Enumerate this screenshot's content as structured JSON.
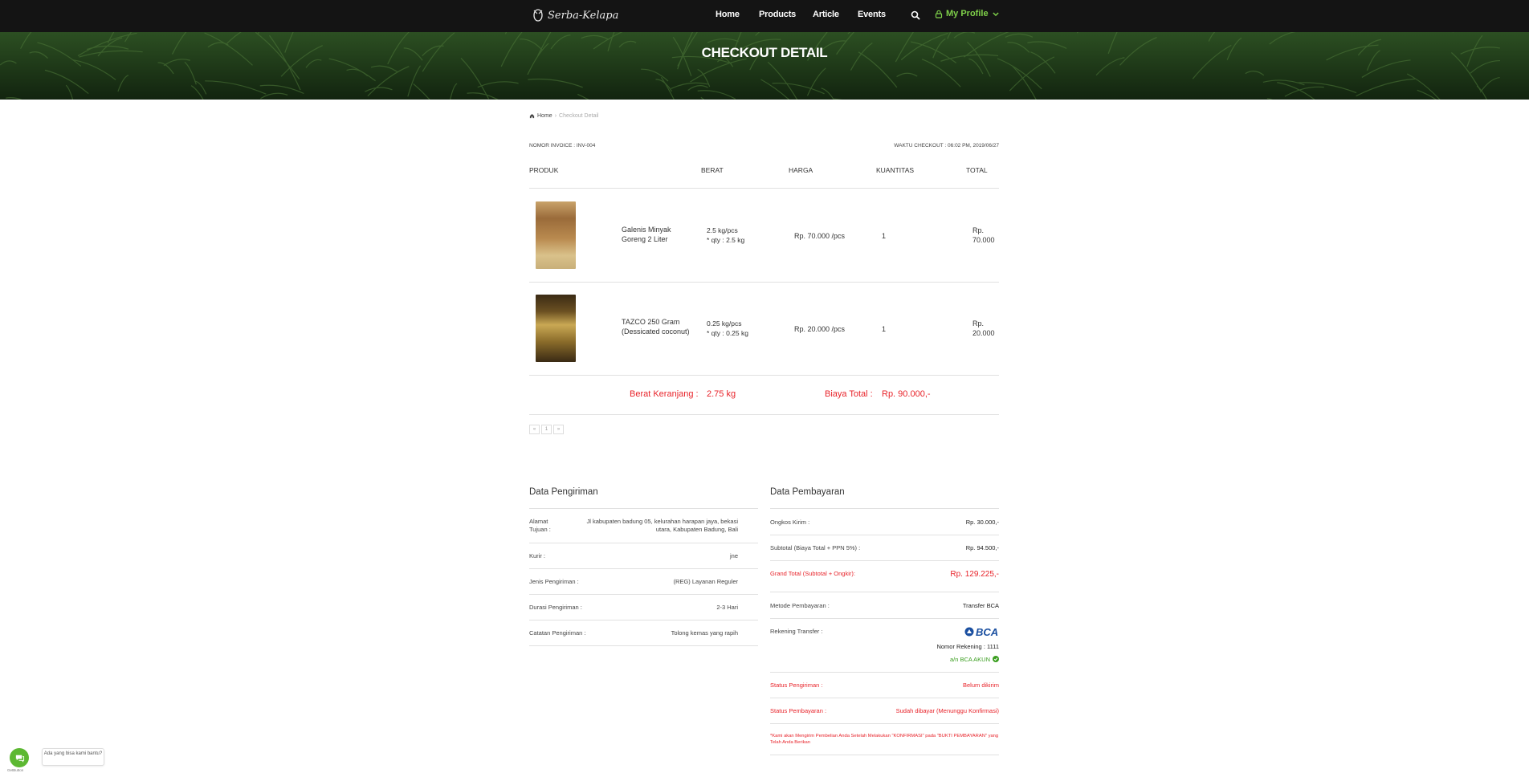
{
  "nav": {
    "logo_text": "Serba-Kelapa",
    "links": [
      "Home",
      "Products",
      "Article",
      "Events"
    ],
    "profile_label": "My Profile"
  },
  "banner": {
    "title": "CHECKOUT DETAIL"
  },
  "breadcrumb": {
    "home": "Home",
    "current": "Checkout Detail"
  },
  "invoice": {
    "number_label": "NOMOR INVOICE : INV-004",
    "time_label": "WAKTU CHECKOUT : 06:02 PM, 2019/06/27"
  },
  "table": {
    "headers": [
      "PRODUK",
      "BERAT",
      "HARGA",
      "KUANTITAS",
      "TOTAL"
    ],
    "rows": [
      {
        "name": "Galenis Minyak Goreng 2 Liter",
        "weight": "2.5 kg/pcs",
        "weight_qty": "* qty : 2.5 kg",
        "price": "Rp. 70.000 /pcs",
        "quantity": "1",
        "total_1": "Rp.",
        "total_2": "70.000"
      },
      {
        "name": "TAZCO 250 Gram (Dessicated coconut)",
        "weight": "0.25 kg/pcs",
        "weight_qty": "* qty : 0.25 kg",
        "price": "Rp. 20.000 /pcs",
        "quantity": "1",
        "total_1": "Rp.",
        "total_2": "20.000"
      }
    ]
  },
  "summary": {
    "weight_label": "Berat Keranjang :",
    "weight_value": "2.75 kg",
    "cost_label": "Biaya Total :",
    "cost_value": "Rp. 90.000,-"
  },
  "pager": {
    "prev": "«",
    "page": "1",
    "next": "»"
  },
  "shipping": {
    "title": "Data Pengiriman",
    "rows": [
      {
        "label": "Alamat Tujuan :",
        "value": "Jl kabupaten badung 05, kelurahan harapan jaya, bekasi utara, Kabupaten Badung, Bali"
      },
      {
        "label": "Kurir :",
        "value": "jne"
      },
      {
        "label": "Jenis Pengiriman :",
        "value": "(REG) Layanan Reguler"
      },
      {
        "label": "Durasi Pengiriman :",
        "value": "2-3 Hari"
      },
      {
        "label": "Catatan Pengiriman :",
        "value": "Tolong kemas yang rapih"
      }
    ]
  },
  "payment": {
    "title": "Data Pembayaran",
    "ongkir_label": "Ongkos Kirim :",
    "ongkir_value": "Rp. 30.000,-",
    "subtotal_label": "Subtotal (Biaya Total + PPN 5%) :",
    "subtotal_value": "Rp. 94.500,-",
    "grand_label": "Grand Total (Subtotal + Ongkir):",
    "grand_value": "Rp. 129.225,-",
    "method_label": "Metode Pembayaran :",
    "method_value": "Transfer BCA",
    "account_label": "Rekening Transfer :",
    "bank_logo": "BCA",
    "account_number": "Nomor Rekening : 1111",
    "account_name": "a/n BCA AKUN",
    "ship_status_label": "Status Pengiriman :",
    "ship_status_value": "Belum dikirim",
    "pay_status_label": "Status Pembayaran :",
    "pay_status_value": "Sudah dibayar (Menunggu Konfirmasi)",
    "note": "*Kami akan Mengirim Pembelian Anda Setelah Melakukan \"KONFIRMASI\" pada \"BUKTI PEMBAYARAN\" yang Telah Anda Berikan"
  },
  "chat": {
    "bubble_text": "Ada yang bisa kami bantu?",
    "brand": "GetButton"
  },
  "colors": {
    "nav_bg": "#141414",
    "accent_green": "#7fd14a",
    "alert_red": "#e8232a",
    "bca_blue": "#1a4fa0"
  }
}
